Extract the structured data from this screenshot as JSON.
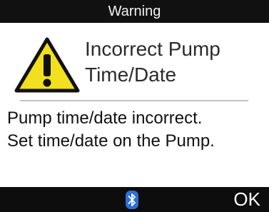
{
  "header": {
    "title": "Warning"
  },
  "alert": {
    "icon": "warning-triangle-icon",
    "heading_line1": "Incorrect Pump",
    "heading_line2": "Time/Date",
    "message_line1": "Pump time/date incorrect.",
    "message_line2": "Set time/date on the Pump."
  },
  "footer": {
    "status_icon": "bluetooth-icon",
    "ok_label": "OK"
  },
  "colors": {
    "bar_background": "#111111",
    "warning_fill": "#f2df20",
    "bluetooth": "#2f6fd6"
  }
}
